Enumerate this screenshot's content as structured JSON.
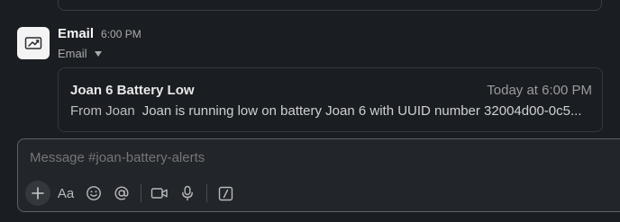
{
  "message": {
    "sender": "Email",
    "time": "6:00 PM",
    "source_label": "Email",
    "avatar_icon": "email-inbox-icon"
  },
  "email_card": {
    "subject": "Joan 6 Battery Low",
    "time": "Today at 6:00 PM",
    "from": "From Joan",
    "preview": "Joan is running low on battery Joan 6 with UUID number 32004d00-0c5..."
  },
  "composer": {
    "placeholder": "Message #joan-battery-alerts",
    "toolbar": [
      {
        "name": "add-icon"
      },
      {
        "name": "formatting-icon",
        "label": "Aa"
      },
      {
        "name": "emoji-icon"
      },
      {
        "name": "mention-icon"
      },
      {
        "name": "video-icon"
      },
      {
        "name": "microphone-icon"
      },
      {
        "name": "shortcuts-icon"
      }
    ]
  },
  "colors": {
    "background": "#1a1d21",
    "composer_bg": "#222529",
    "border": "#35373b",
    "text_muted": "#ababad"
  }
}
